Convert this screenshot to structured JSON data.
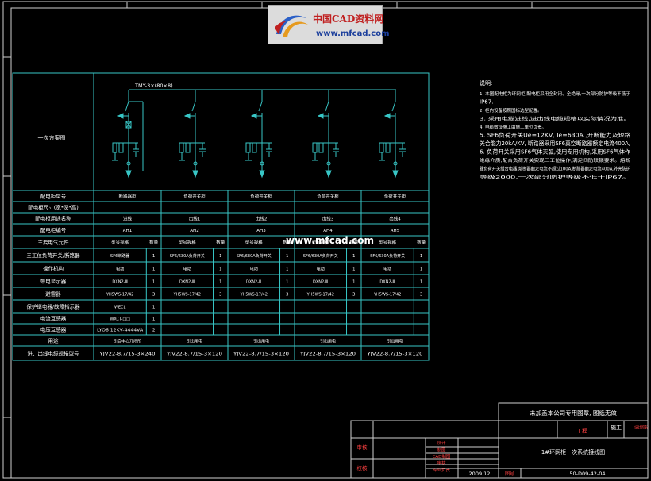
{
  "logo": {
    "name": "中国CAD资料网",
    "url": "www.mfcad.com"
  },
  "watermark": "www.mfcad.com",
  "diagram": {
    "row_header": "一次方案图",
    "busbar_label": "TMY-3×(80×8)"
  },
  "table": {
    "rows": [
      {
        "label": "配电柜型号",
        "values": [
          "断路器柜",
          "负荷开关柜",
          "负荷开关柜",
          "负荷开关柜",
          "负荷开关柜"
        ]
      },
      {
        "label": "配电柜尺寸(宽*深*高)",
        "values": [
          "",
          "",
          "",
          "",
          ""
        ]
      },
      {
        "label": "配电柜用途名称",
        "values": [
          "进线",
          "出线1",
          "出线2",
          "出线3",
          "出线4"
        ]
      },
      {
        "label": "配电柜编号",
        "values": [
          "AH1",
          "AH2",
          "AH3",
          "AH4",
          "AH5"
        ]
      }
    ],
    "component_header": "主要电气元件",
    "sub_headers": [
      "型号规格",
      "数量"
    ],
    "components": [
      {
        "label": "三工位负荷开关/断路器",
        "cells": [
          [
            "SF6断路器",
            "1"
          ],
          [
            "SF6/630A负荷开关",
            "1"
          ],
          [
            "SF6/630A负荷开关",
            "1"
          ],
          [
            "SF6/630A负荷开关",
            "1"
          ],
          [
            "SF6/630A负荷开关",
            "1"
          ]
        ]
      },
      {
        "label": "操作机构",
        "cells": [
          [
            "电动",
            "1"
          ],
          [
            "电动",
            "1"
          ],
          [
            "电动",
            "1"
          ],
          [
            "电动",
            "1"
          ],
          [
            "电动",
            "1"
          ]
        ]
      },
      {
        "label": "带电显示器",
        "cells": [
          [
            "DXN2-Ⅲ",
            "1"
          ],
          [
            "DXN2-Ⅲ",
            "1"
          ],
          [
            "DXN2-Ⅲ",
            "1"
          ],
          [
            "DXN2-Ⅲ",
            "1"
          ],
          [
            "DXN2-Ⅲ",
            "1"
          ]
        ]
      },
      {
        "label": "避雷器",
        "cells": [
          [
            "YH5WS-17/42",
            "3"
          ],
          [
            "YH5WS-17/42",
            "3"
          ],
          [
            "YH5WS-17/42",
            "3"
          ],
          [
            "YH5WS-17/42",
            "3"
          ],
          [
            "YH5WS-17/42",
            "3"
          ]
        ]
      },
      {
        "label": "保护继电器/故障指示器",
        "cells": [
          [
            "WECL",
            "1"
          ],
          [
            "",
            ""
          ],
          [
            "",
            ""
          ],
          [
            "",
            ""
          ],
          [
            "",
            ""
          ]
        ]
      },
      {
        "label": "电流互感器",
        "cells": [
          [
            "WXCT-□□",
            "1"
          ],
          [
            "",
            ""
          ],
          [
            "",
            ""
          ],
          [
            "",
            ""
          ],
          [
            "",
            ""
          ]
        ]
      },
      {
        "label": "电压互感器",
        "cells": [
          [
            "LYO6 12KV-4444VA",
            "2"
          ],
          [
            "",
            ""
          ],
          [
            "",
            ""
          ],
          [
            "",
            ""
          ],
          [
            "",
            ""
          ]
        ]
      },
      {
        "label": "用途",
        "cells": [
          [
            "引自中心开闭所",
            ""
          ],
          [
            "引出用电",
            ""
          ],
          [
            "引出用电",
            ""
          ],
          [
            "引出用电",
            ""
          ],
          [
            "引出用电",
            ""
          ]
        ]
      },
      {
        "label": "进、出线电缆规格型号",
        "cells": [
          [
            "YJV22-8.7/15-3×240",
            ""
          ],
          [
            "YJV22-8.7/15-3×120",
            ""
          ],
          [
            "YJV22-8.7/15-3×120",
            ""
          ],
          [
            "YJV22-8.7/15-3×120",
            ""
          ],
          [
            "YJV22-8.7/15-3×120",
            ""
          ]
        ]
      }
    ]
  },
  "notes": {
    "title": "说明:",
    "lines": [
      "1. 本图配电柜为环网柜,配电柜采用全封闭、全绝缘,一次部分防护等级不低于",
      "IP67.",
      "2. 柜内设备按照国标选型配置。",
      "3. 采用电缆进线,进出线电缆规格以实际情况为准。",
      "4. 电缆敷设施工由施工单位负责。",
      "5. SF6负荷开关Ue=12KV, Ie=630A ,开断能力及短路",
      "关合能力20kA/KV, 断路器采用SF6真空断路器额定电流400A,",
      "6. 负荷开关采用SF6气体灭弧,使用专用机构,采用SF6气体作",
      "绝缘介质,配合负荷开关实现三工位操作,满足四防联锁要求。熔断",
      "器负荷开关组合电器,熔断器额定电流不超过100A,断路器额定电流400A,外壳防护",
      "等级2000,一次部分防护等级不低于IP67。"
    ]
  },
  "title_block": {
    "notice": "未加盖本公司专用图章, 图纸无效",
    "project_label": "工程",
    "stage_label": "设计阶段",
    "stage": "施工",
    "drawing_title": "1#环网柜一次系统接线图",
    "left_labels": [
      "审核",
      "校核"
    ],
    "role_labels": [
      "设计",
      "制图",
      "CAD制图",
      "审核",
      "专业负责"
    ],
    "date": "2009.12",
    "sheet_label": "图号",
    "drawing_no": "50-D09-42-04"
  }
}
